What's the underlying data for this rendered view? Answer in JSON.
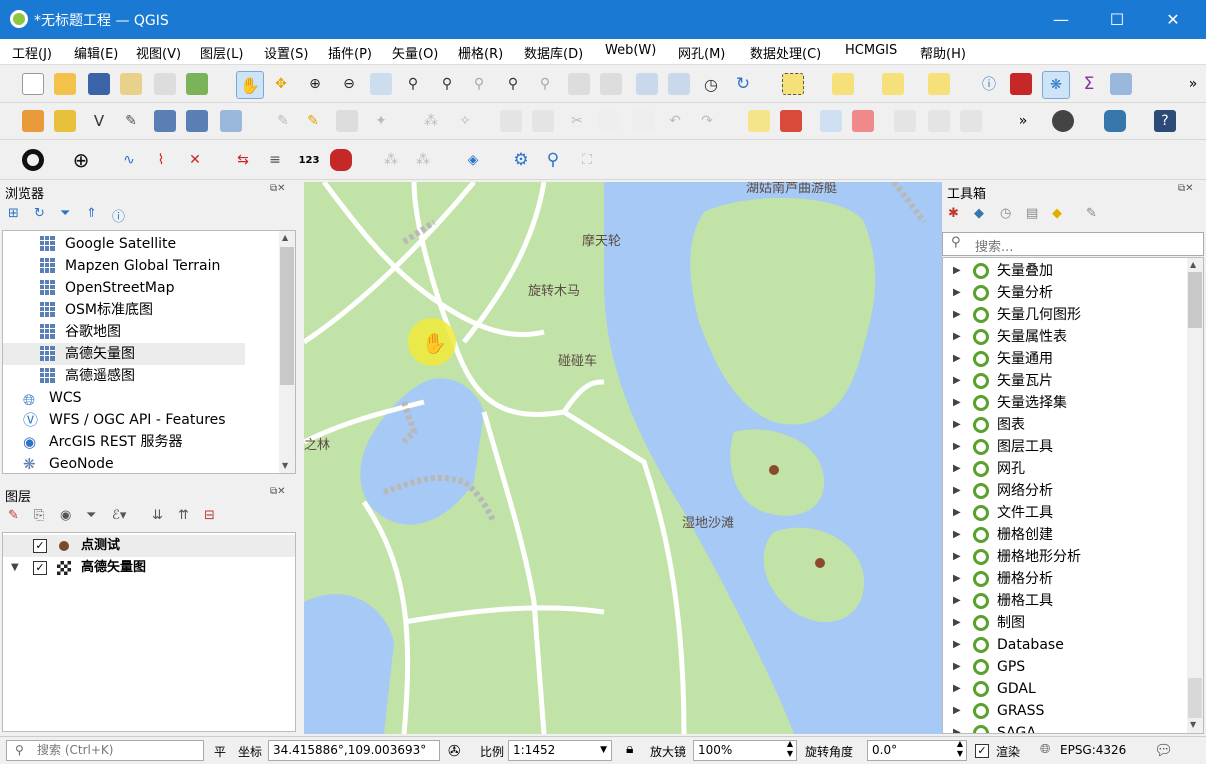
{
  "window": {
    "title": "*无标题工程 — QGIS",
    "min": "—",
    "max": "☐",
    "close": "✕"
  },
  "menu": [
    "工程(J)",
    "编辑(E)",
    "视图(V)",
    "图层(L)",
    "设置(S)",
    "插件(P)",
    "矢量(O)",
    "栅格(R)",
    "数据库(D)",
    "Web(W)",
    "网孔(M)",
    "数据处理(C)",
    "HCMGIS",
    "帮助(H)"
  ],
  "toolbar_overflow": "»",
  "digit_label": "123",
  "browser": {
    "title": "浏览器",
    "items": [
      {
        "label": "Google Satellite",
        "icon": "xyz-grid-icon"
      },
      {
        "label": "Mapzen Global Terrain",
        "icon": "xyz-grid-icon"
      },
      {
        "label": "OpenStreetMap",
        "icon": "xyz-grid-icon"
      },
      {
        "label": "OSM标准底图",
        "icon": "xyz-grid-icon"
      },
      {
        "label": "谷歌地图",
        "icon": "xyz-grid-icon"
      },
      {
        "label": "高德矢量图",
        "icon": "xyz-grid-icon"
      },
      {
        "label": "高德遥感图",
        "icon": "xyz-grid-icon"
      },
      {
        "label": "WCS",
        "icon": "globe-icon"
      },
      {
        "label": "WFS / OGC API - Features",
        "icon": "wfs-icon"
      },
      {
        "label": "ArcGIS REST 服务器",
        "icon": "arcgis-icon"
      },
      {
        "label": "GeoNode",
        "icon": "geonode-icon"
      }
    ]
  },
  "layers": {
    "title": "图层",
    "items": [
      {
        "label": "点测试",
        "checked": "✓"
      },
      {
        "label": "高德矢量图",
        "checked": "✓"
      }
    ]
  },
  "toolbox": {
    "title": "工具箱",
    "search_placeholder": "搜索...",
    "items": [
      "矢量叠加",
      "矢量分析",
      "矢量几何图形",
      "矢量属性表",
      "矢量通用",
      "矢量瓦片",
      "矢量选择集",
      "图表",
      "图层工具",
      "网孔",
      "网络分析",
      "文件工具",
      "栅格创建",
      "栅格地形分析",
      "栅格分析",
      "栅格工具",
      "制图",
      "Database",
      "GPS",
      "GDAL",
      "GRASS",
      "SAGA"
    ]
  },
  "map": {
    "labels": [
      "湖姑南芦曲游艇",
      "摩天轮",
      "旋转木马",
      "碰碰车",
      "湿地沙滩",
      "之林"
    ],
    "water_color": "#a6c9f5",
    "land_color": "#c2e3a8",
    "road_color": "#ffffff",
    "point_color": "#8b4a2b"
  },
  "status": {
    "search_placeholder": "搜索 (Ctrl+K)",
    "pan": "平",
    "coord_label": "坐标",
    "coord": "34.415886°,109.003693°",
    "scale_label": "比例",
    "scale": "1:1452",
    "magnifier_label": "放大镜",
    "magnifier": "100%",
    "rotation_label": "旋转角度",
    "rotation": "0.0°",
    "render_label": "渲染",
    "render_checked": "✓",
    "crs": "EPSG:4326"
  }
}
